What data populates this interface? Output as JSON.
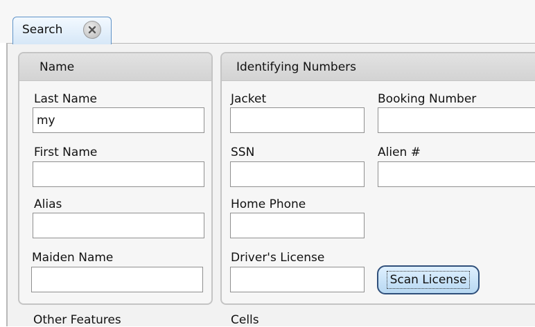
{
  "tab": {
    "label": "Search",
    "close_icon": "close-icon"
  },
  "name_group": {
    "title": "Name",
    "fields": {
      "last_name": {
        "label": "Last Name",
        "value": "my"
      },
      "first_name": {
        "label": "First Name",
        "value": ""
      },
      "alias": {
        "label": "Alias",
        "value": ""
      },
      "maiden_name": {
        "label": "Maiden Name",
        "value": ""
      }
    }
  },
  "ids_group": {
    "title": "Identifying Numbers",
    "fields": {
      "jacket": {
        "label": "Jacket",
        "value": ""
      },
      "booking_number": {
        "label": "Booking Number",
        "value": ""
      },
      "ssn": {
        "label": "SSN",
        "value": ""
      },
      "alien_number": {
        "label": "Alien #",
        "value": ""
      },
      "home_phone": {
        "label": "Home Phone",
        "value": ""
      },
      "drivers_license": {
        "label": "Driver's License",
        "value": ""
      }
    },
    "scan_button_label": "Scan License"
  },
  "bottom_sections": {
    "other_features": "Other Features",
    "cells": "Cells"
  },
  "colors": {
    "tab_border": "#5f93c8",
    "tab_fill": "#d6e7f7",
    "panel_bg": "#f2f2f2",
    "group_border": "#c4c4c4",
    "button_border": "#2f4f7a"
  }
}
